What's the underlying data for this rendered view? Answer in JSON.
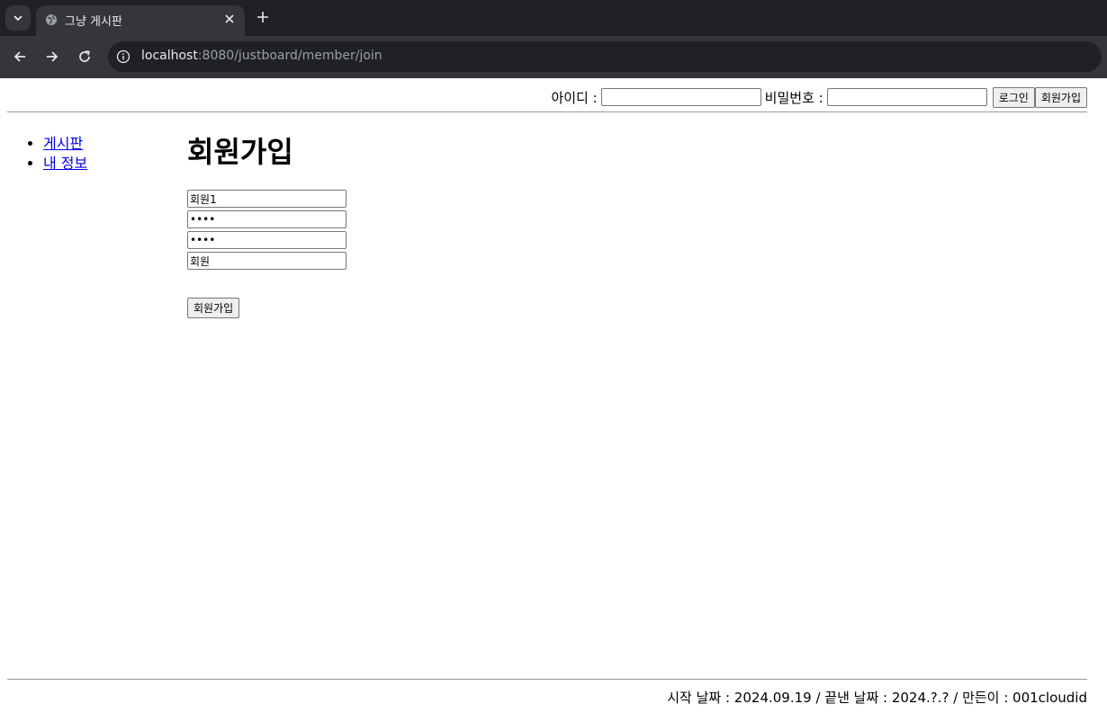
{
  "browser": {
    "tab": {
      "title": "그냥 게시판"
    },
    "url": {
      "host": "localhost",
      "path": ":8080/justboard/member/join"
    },
    "icons": {
      "tab_search": "chevron-down-icon",
      "favicon": "globe-icon",
      "close": "close-icon",
      "new_tab": "plus-icon",
      "back": "arrow-left-icon",
      "forward": "arrow-right-icon",
      "reload": "reload-icon",
      "site_info": "info-icon"
    }
  },
  "login_bar": {
    "id_label": "아이디 :",
    "id_value": "",
    "pw_label": "비밀번호 :",
    "pw_value": "",
    "login_button": "로그인",
    "signup_button": "회원가입"
  },
  "nav": {
    "items": [
      {
        "label": "게시판"
      },
      {
        "label": "내 정보"
      }
    ]
  },
  "main": {
    "title": "회원가입",
    "form": {
      "username": "회원1",
      "password": "••••",
      "password_confirm": "••••",
      "name": "회원"
    },
    "submit_label": "회원가입"
  },
  "footer": {
    "text": "시작 날짜 : 2024.09.19 / 끝낸 날짜 : 2024.?.? / 만든이 : 001cloudid"
  },
  "colors": {
    "chrome_dark": "#202124",
    "chrome_tab": "#35363a",
    "link": "#0000ee"
  }
}
